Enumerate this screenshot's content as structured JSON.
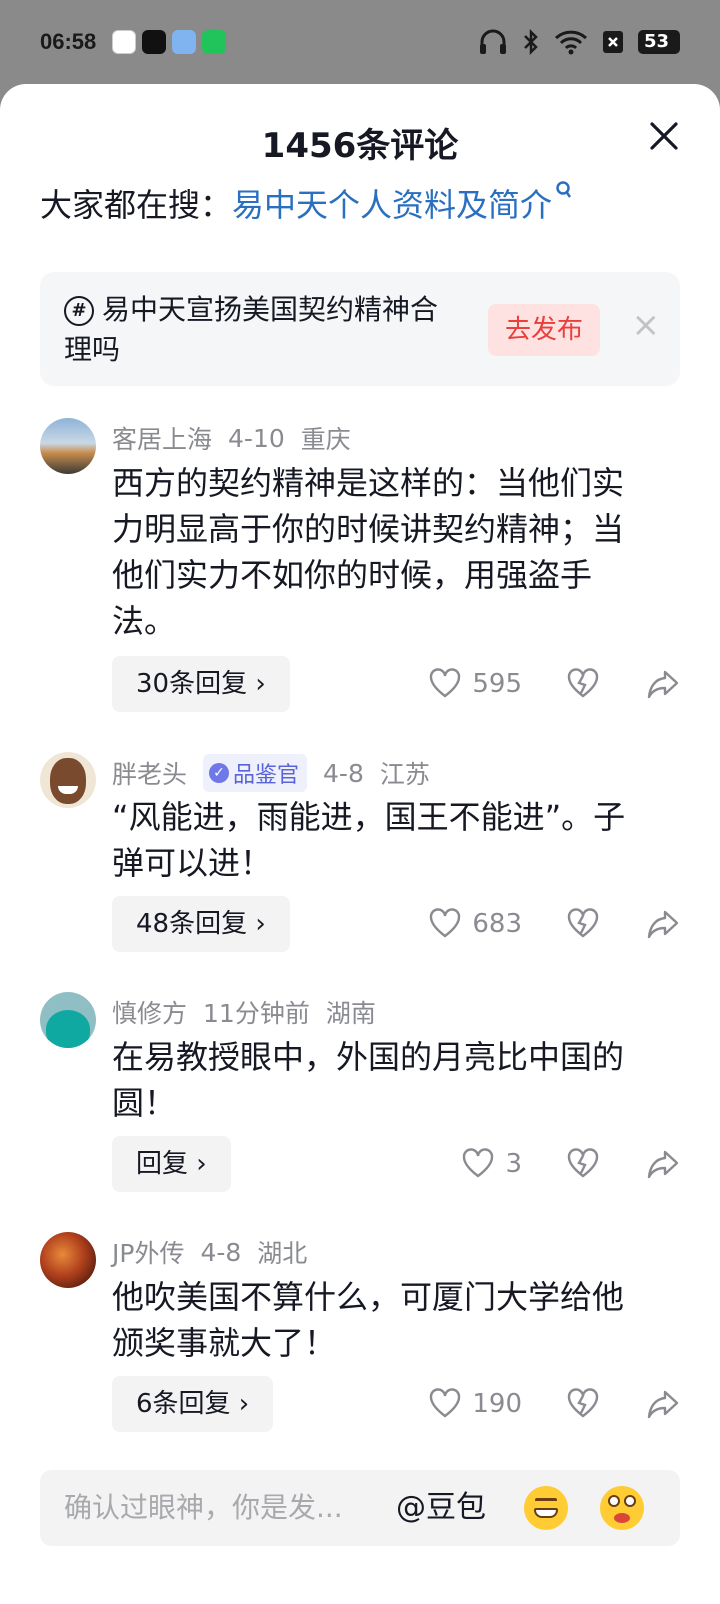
{
  "status_bar": {
    "time": "06:58",
    "app_icons": [
      "home-app-icon",
      "tiktok-icon",
      "weather-icon",
      "wechat-icon"
    ],
    "right_icons": [
      "headphones-icon",
      "bluetooth-icon",
      "wifi-icon",
      "close-box-icon",
      "battery-icon"
    ],
    "battery_level": "53"
  },
  "sheet": {
    "title": "1456条评论",
    "search_prefix": "大家都在搜：",
    "search_link": "易中天个人资料及简介"
  },
  "topic": {
    "text": "易中天宣扬美国契约精神合理吗",
    "publish_label": "去发布"
  },
  "comments": [
    {
      "author": "客居上海",
      "date": "4-10",
      "location": "重庆",
      "text": "西方的契约精神是这样的：当他们实力明显高于你的时候讲契约精神；当他们实力不如你的时候，用强盗手法。",
      "reply_label": "30条回复",
      "likes": "595"
    },
    {
      "author": "胖老头",
      "badge": "品鉴官",
      "date": "4-8",
      "location": "江苏",
      "text": "“风能进，雨能进，国王不能进”。子弹可以进！",
      "reply_label": "48条回复",
      "likes": "683"
    },
    {
      "author": "慎修方",
      "date": "11分钟前",
      "location": "湖南",
      "text": "在易教授眼中，外国的月亮比中国的圆！",
      "reply_label": "回复",
      "likes": "3"
    },
    {
      "author": "JP外传",
      "date": "4-8",
      "location": "湖北",
      "text": "他吹美国不算什么，可厦门大学给他颁奖事就大了！",
      "reply_label": "6条回复",
      "likes": "190"
    }
  ],
  "input": {
    "placeholder": "确认过眼神，你是发...",
    "mention": "@豆包"
  },
  "colors": {
    "link": "#2a6fc0",
    "publish_bg": "#fde2e1",
    "publish_text": "#e8413c",
    "meta": "#8a8b91"
  }
}
